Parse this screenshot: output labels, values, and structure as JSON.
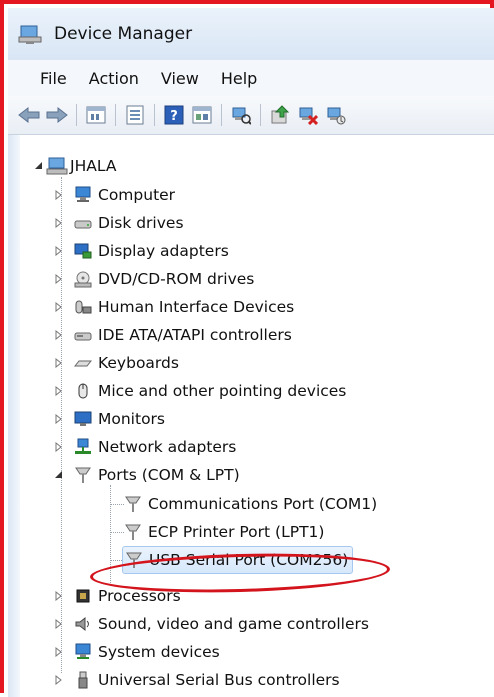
{
  "window": {
    "title": "Device Manager"
  },
  "menu": [
    "File",
    "Action",
    "View",
    "Help"
  ],
  "toolbar": [
    "back-arrow-icon",
    "forward-arrow-icon",
    "properties-icon",
    "details-icon",
    "help-icon",
    "view-icon",
    "scan-hardware-icon",
    "update-driver-icon",
    "uninstall-icon",
    "disable-icon"
  ],
  "tree": {
    "root": "JHALA",
    "categories": [
      "Computer",
      "Disk drives",
      "Display adapters",
      "DVD/CD-ROM drives",
      "Human Interface Devices",
      "IDE ATA/ATAPI controllers",
      "Keyboards",
      "Mice and other pointing devices",
      "Monitors",
      "Network adapters",
      "Ports (COM & LPT)"
    ],
    "ports_children": [
      "Communications Port (COM1)",
      "ECP Printer Port (LPT1)",
      "USB Serial Port (COM256)"
    ],
    "after": [
      "Processors",
      "Sound, video and game controllers",
      "System devices",
      "Universal Serial Bus controllers"
    ]
  }
}
